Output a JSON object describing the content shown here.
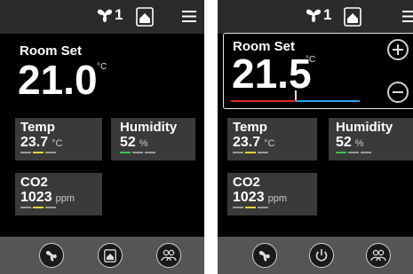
{
  "colors": {
    "panel_bg": "#000000",
    "tile_bg": "#3a3a3a",
    "bar_bg": "#2b2b2b",
    "bottom_bg": "#555555",
    "accent_yellow": "#f2d23c",
    "accent_green": "#3cc24a",
    "setpoint_red": "#e12b2b",
    "setpoint_blue": "#2aa2e8"
  },
  "screens": [
    {
      "status": {
        "fan_speed": "1",
        "fan_icon": "fan-icon",
        "house_icon": "house-icon",
        "menu_icon": "menu-icon"
      },
      "room_set": {
        "label": "Room Set",
        "value": "21.0",
        "unit": "°C"
      },
      "temp": {
        "label": "Temp",
        "value": "23.7",
        "unit": "°C"
      },
      "humidity": {
        "label": "Humidity",
        "value": "52",
        "unit": "%"
      },
      "co2": {
        "label": "CO2",
        "value": "1023",
        "unit": "ppm"
      },
      "bottom_buttons": [
        "fan-button",
        "home-button",
        "people-button"
      ]
    },
    {
      "status": {
        "fan_speed": "1",
        "fan_icon": "fan-icon",
        "house_icon": "house-icon",
        "menu_icon": "menu-icon"
      },
      "room_set": {
        "label": "Room Set",
        "value": "21.5",
        "unit": "°C",
        "slider_level": 0.5
      },
      "temp": {
        "label": "Temp",
        "value": "23.7",
        "unit": "°C"
      },
      "humidity": {
        "label": "Humidity",
        "value": "52",
        "unit": "%"
      },
      "co2": {
        "label": "CO2",
        "value": "1023",
        "unit": "ppm"
      },
      "bottom_buttons": [
        "fan-button",
        "power-button",
        "people-button"
      ]
    }
  ]
}
